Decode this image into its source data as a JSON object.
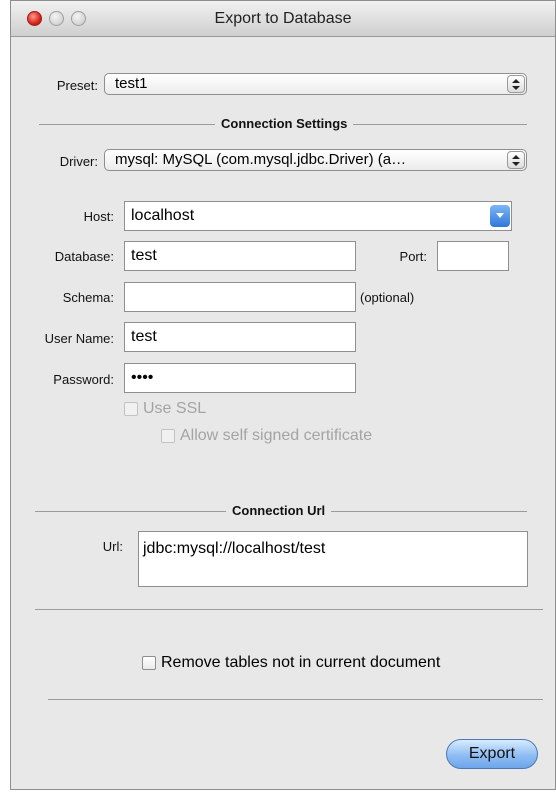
{
  "window": {
    "title": "Export to Database"
  },
  "preset": {
    "label": "Preset:",
    "value": "test1"
  },
  "connection_settings": {
    "heading": "Connection Settings"
  },
  "driver": {
    "label": "Driver:",
    "value": "mysql: MySQL (com.mysql.jdbc.Driver)  (a…"
  },
  "host": {
    "label": "Host:",
    "value": "localhost"
  },
  "database": {
    "label": "Database:",
    "value": "test"
  },
  "port": {
    "label": "Port:",
    "value": ""
  },
  "schema": {
    "label": "Schema:",
    "value": "",
    "hint": "(optional)"
  },
  "username": {
    "label": "User Name:",
    "value": "test"
  },
  "password": {
    "label": "Password:",
    "value": "••••"
  },
  "ssl": {
    "label": "Use SSL",
    "self_signed_label": "Allow self signed certificate"
  },
  "connection_url": {
    "heading": "Connection Url",
    "label": "Url:",
    "value": "jdbc:mysql://localhost/test"
  },
  "remove_tables": {
    "label": "Remove tables not in current document"
  },
  "export_button": {
    "label": "Export"
  }
}
